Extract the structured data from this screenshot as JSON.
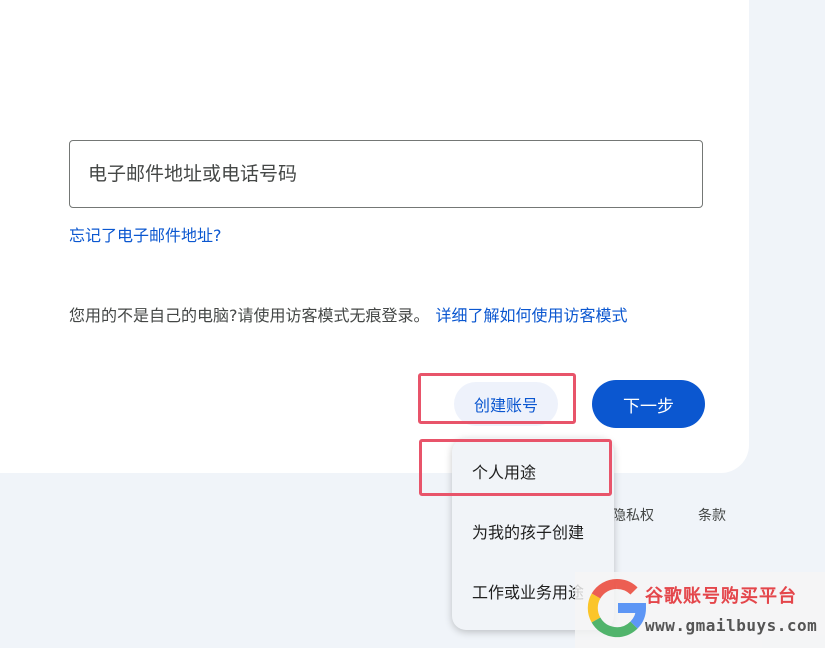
{
  "login": {
    "email_placeholder": "电子邮件地址或电话号码",
    "email_value": "",
    "forgot_link": "忘记了电子邮件地址?",
    "guest_notice": "您用的不是自己的电脑?请使用访客模式无痕登录。",
    "guest_link": "详细了解如何使用访客模式",
    "create_account_label": "创建账号",
    "next_label": "下一步"
  },
  "create_menu": {
    "items": [
      {
        "label": "个人用途"
      },
      {
        "label": "为我的孩子创建"
      },
      {
        "label": "工作或业务用途"
      }
    ]
  },
  "footer": {
    "privacy": "隐私权",
    "terms": "条款"
  },
  "watermark": {
    "title": "谷歌账号购买平台",
    "url": "www.gmailbuys.com"
  },
  "colors": {
    "accent": "#0b57d0",
    "highlight": "#e8546a",
    "watermark_red": "#e4464b"
  }
}
